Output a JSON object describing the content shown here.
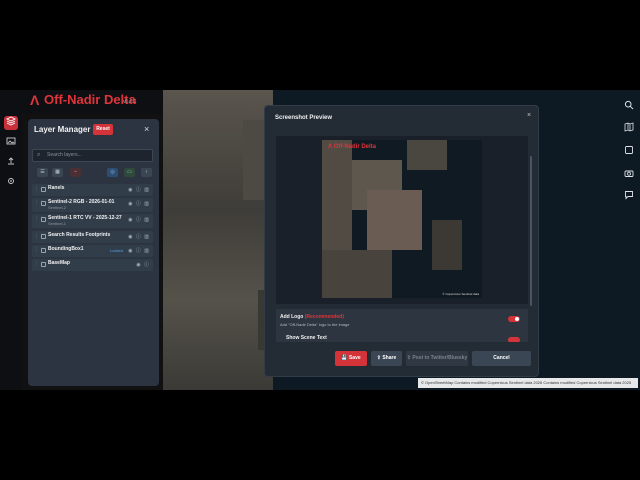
{
  "app": {
    "logo_mark": "Λ",
    "title": "Off-Nadir Delta",
    "version": "v0.0.1"
  },
  "left_rail": {
    "icons": [
      "layers-icon",
      "image-icon",
      "upload-icon",
      "settings-icon"
    ]
  },
  "layer_manager": {
    "title": "Layer Manager",
    "reset_label": "Reset",
    "close": "×",
    "search_placeholder": "Search layers...",
    "layers": [
      {
        "name": "Ranels",
        "sub": ""
      },
      {
        "name": "Sentinel-2 RGB - 2026-01-01",
        "sub": "Sentinel-2"
      },
      {
        "name": "Sentinel-1 RTC VV - 2025-12-27",
        "sub": "Sentinel-1"
      },
      {
        "name": "Search Results Footprints",
        "sub": ""
      },
      {
        "name": "BoundingBox1",
        "sub": "",
        "tag": "Locked"
      },
      {
        "name": "BaseMap",
        "sub": ""
      }
    ]
  },
  "right_rail": {
    "icons": [
      "search-icon",
      "map-icon",
      "square-icon",
      "camera-icon",
      "chat-icon"
    ]
  },
  "screenshot_modal": {
    "title": "Screenshot Preview",
    "close": "×",
    "preview_logo": "Λ Off-Nadir Delta",
    "preview_attr": "© Copernicus Sentinel data",
    "options": [
      {
        "label": "Add Logo",
        "recommended": "(Recommended)",
        "desc": "Add \"Off-Nadir Delta\" logo to the image",
        "enabled": true
      },
      {
        "label": "Show Scene Text",
        "enabled": true
      }
    ],
    "buttons": {
      "save": "Save",
      "share": "Share",
      "post": "Post to Twitter/Bluesky",
      "cancel": "Cancel"
    }
  },
  "attribution": "© OpenStreetMap Contains modified Copernicus Sentinel data 2026 Contains modified Copernicus Sentinel data 2025"
}
